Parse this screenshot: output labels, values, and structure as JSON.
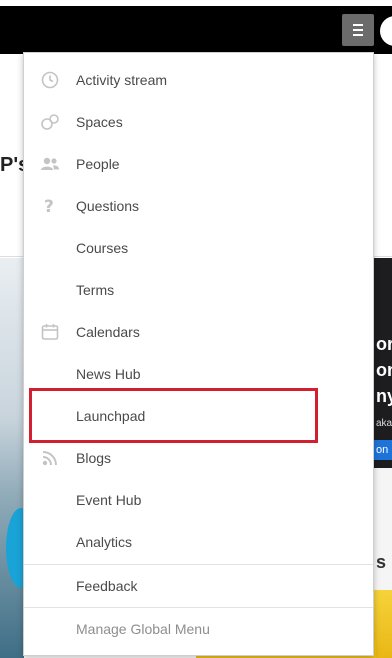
{
  "background": {
    "title_fragment": "P's",
    "card_lines": [
      "or",
      "on",
      "ny"
    ],
    "card_small": "aka",
    "card_button": "on",
    "card2_text": "s"
  },
  "menu": {
    "items": [
      {
        "label": "Activity stream",
        "icon": "clock-icon"
      },
      {
        "label": "Spaces",
        "icon": "spaces-icon"
      },
      {
        "label": "People",
        "icon": "people-icon"
      },
      {
        "label": "Questions",
        "icon": "question-icon"
      },
      {
        "label": "Courses",
        "icon": ""
      },
      {
        "label": "Terms",
        "icon": ""
      },
      {
        "label": "Calendars",
        "icon": "calendar-icon"
      },
      {
        "label": "News Hub",
        "icon": ""
      },
      {
        "label": "Launchpad",
        "icon": ""
      },
      {
        "label": "Blogs",
        "icon": "rss-icon"
      },
      {
        "label": "Event Hub",
        "icon": ""
      },
      {
        "label": "Analytics",
        "icon": ""
      }
    ],
    "feedback": "Feedback",
    "manage": "Manage Global Menu"
  },
  "highlight_color": "#d32030"
}
